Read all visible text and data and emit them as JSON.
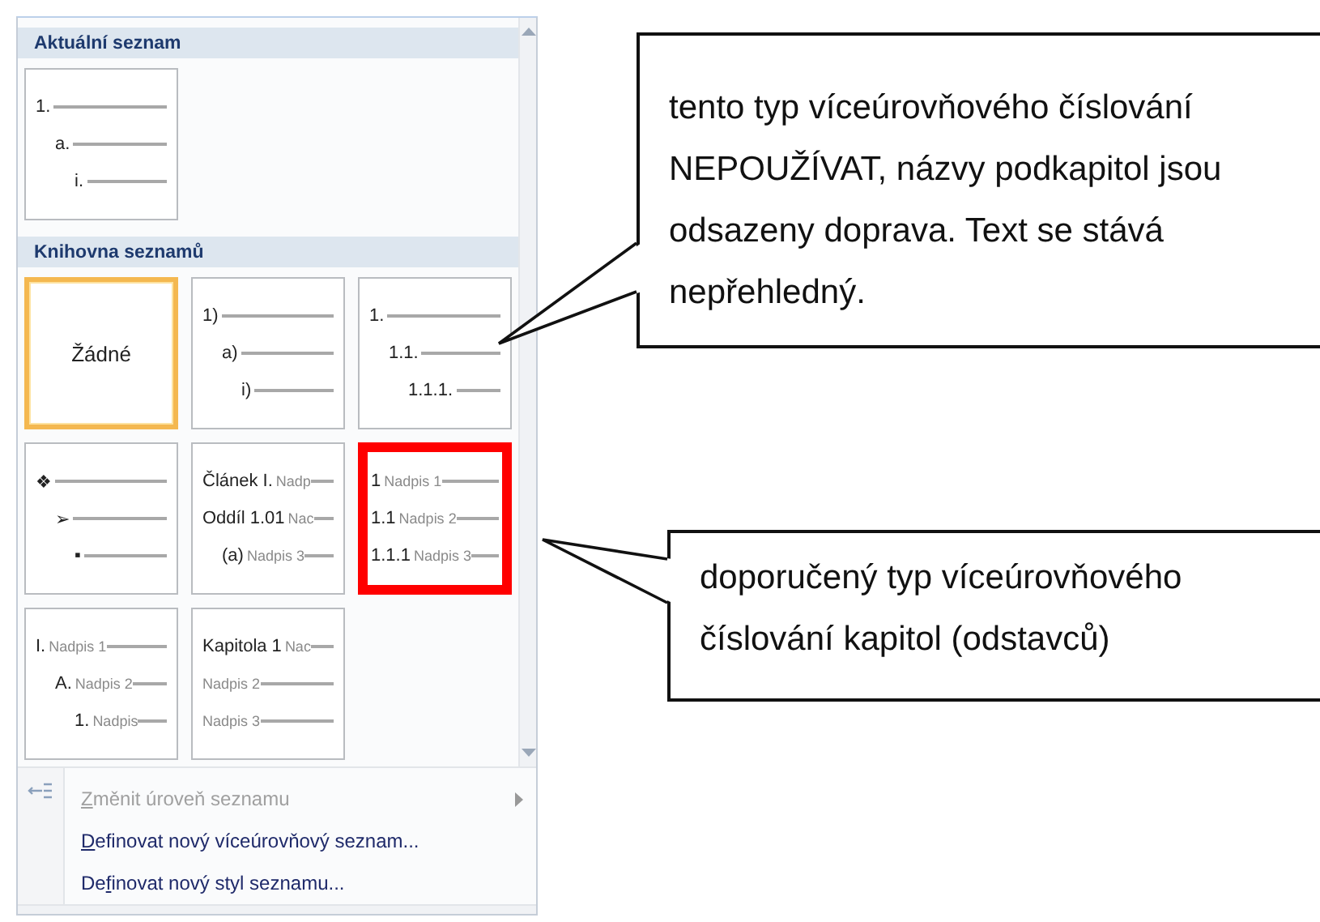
{
  "gallery": {
    "sections": [
      {
        "title": "Aktuální seznam",
        "tiles": [
          {
            "kind": "list",
            "selected": false,
            "highlighted": false,
            "lines": [
              {
                "label": "1.",
                "children": [
                  {
                    "label": "a.",
                    "children": [
                      {
                        "label": "i."
                      }
                    ]
                  }
                ]
              }
            ]
          }
        ]
      },
      {
        "title": "Knihovna seznamů",
        "tiles": [
          {
            "kind": "none",
            "selected": true,
            "highlighted": false,
            "text": "Žádné"
          },
          {
            "kind": "list",
            "selected": false,
            "highlighted": false,
            "lines": [
              {
                "label": "1)",
                "children": [
                  {
                    "label": "a)",
                    "children": [
                      {
                        "label": "i)"
                      }
                    ]
                  }
                ]
              }
            ]
          },
          {
            "kind": "list",
            "selected": false,
            "highlighted": false,
            "lines": [
              {
                "label": "1.",
                "children": [
                  {
                    "label": "1.1.",
                    "children": [
                      {
                        "label": "1.1.1."
                      }
                    ]
                  }
                ]
              }
            ]
          },
          {
            "kind": "list",
            "selected": false,
            "highlighted": false,
            "lines": [
              {
                "label": "❖",
                "children": [
                  {
                    "label": "➢",
                    "children": [
                      {
                        "label": "▪"
                      }
                    ]
                  }
                ]
              }
            ]
          },
          {
            "kind": "list",
            "selected": false,
            "highlighted": false,
            "lines": [
              {
                "label": "Článek I.",
                "sub": "Nadp"
              },
              {
                "label": "Oddíl 1.01",
                "sub": "Nac",
                "children": [
                  {
                    "label": "(a)",
                    "sub": "Nadpis 3"
                  }
                ]
              }
            ]
          },
          {
            "kind": "list",
            "selected": false,
            "highlighted": true,
            "lines": [
              {
                "label": "1",
                "sub": "Nadpis 1"
              },
              {
                "label": "1.1",
                "sub": "Nadpis 2"
              },
              {
                "label": "1.1.1",
                "sub": "Nadpis 3"
              }
            ]
          },
          {
            "kind": "list",
            "selected": false,
            "highlighted": false,
            "lines": [
              {
                "label": "I.",
                "sub": "Nadpis 1",
                "children": [
                  {
                    "label": "A.",
                    "sub": "Nadpis 2",
                    "children": [
                      {
                        "label": "1.",
                        "sub": "Nadpis"
                      }
                    ]
                  }
                ]
              }
            ]
          },
          {
            "kind": "list",
            "selected": false,
            "highlighted": false,
            "lines": [
              {
                "label": "Kapitola 1",
                "sub": "Nac"
              },
              {
                "sub": "Nadpis 2"
              },
              {
                "sub": "Nadpis 3"
              }
            ]
          }
        ]
      }
    ]
  },
  "menu_items": [
    {
      "key": "Z",
      "post": "měnit úroveň seznamu",
      "disabled": true,
      "submenu": true,
      "icon": true
    },
    {
      "key": "D",
      "post": "efinovat nový víceúrovňový seznam...",
      "disabled": false,
      "submenu": false,
      "icon": false
    },
    {
      "pre": "De",
      "key": "f",
      "post": "inovat nový styl seznamu...",
      "disabled": false,
      "submenu": false,
      "icon": false
    }
  ],
  "callouts": [
    {
      "kind": "upper",
      "text": "tento typ víceúrovňového číslování NEPOUŽÍVAT, názvy podkapitol jsou odsazeny doprava. Text se stává nepřehledný."
    },
    {
      "kind": "lower",
      "text": "doporučený typ víceúrovňového číslování kapitol (odstavců)"
    }
  ]
}
